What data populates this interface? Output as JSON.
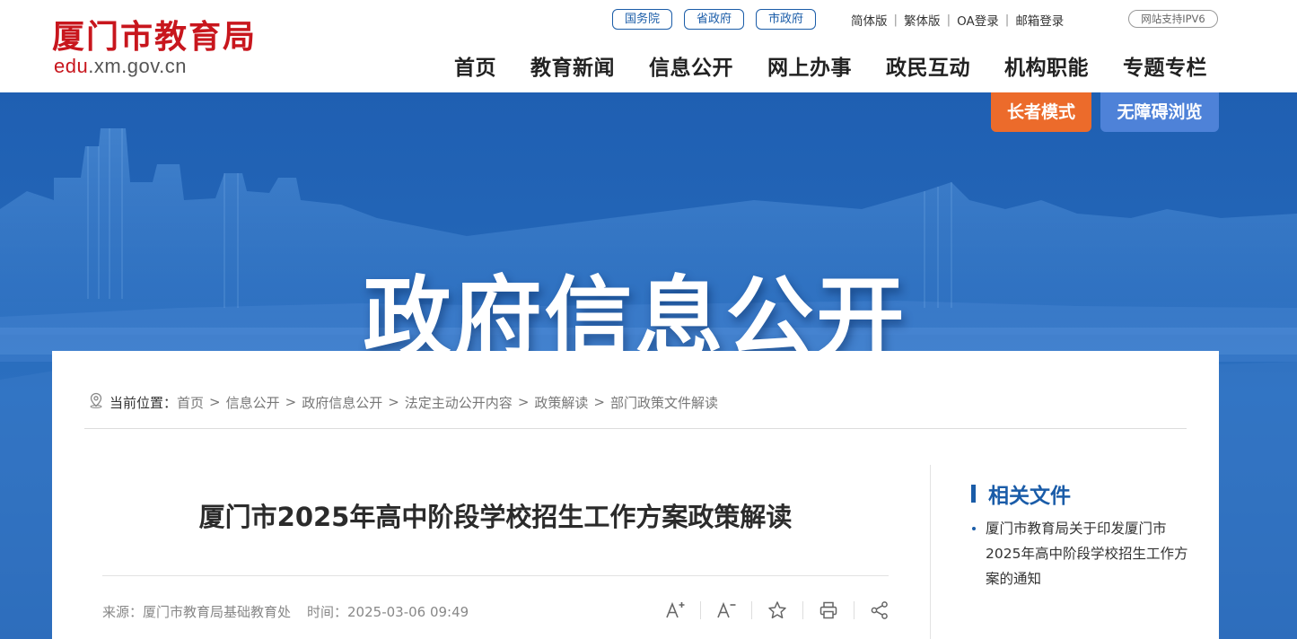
{
  "brand": {
    "title": "厦门市教育局",
    "domain_red": "edu",
    "domain_rest": ".xm.gov.cn"
  },
  "top_pills": [
    "国务院",
    "省政府",
    "市政府"
  ],
  "utility_links": [
    "简体版",
    "繁体版",
    "OA登录",
    "邮箱登录"
  ],
  "ipv6_badge": "网站支持IPV6",
  "nav": [
    "首页",
    "教育新闻",
    "信息公开",
    "网上办事",
    "政民互动",
    "机构职能",
    "专题专栏"
  ],
  "modes": {
    "elder": "长者模式",
    "accessible": "无障碍浏览"
  },
  "banner_title": "政府信息公开",
  "breadcrumb": {
    "label": "当前位置：",
    "items": [
      "首页",
      "信息公开",
      "政府信息公开",
      "法定主动公开内容",
      "政策解读",
      "部门政策文件解读"
    ],
    "separator": ">"
  },
  "article": {
    "title": "厦门市2025年高中阶段学校招生工作方案政策解读",
    "source": "来源：厦门市教育局基础教育处",
    "time": "时间：2025-03-06 09:49"
  },
  "tools": [
    "font-increase-icon",
    "font-decrease-icon",
    "star-icon",
    "print-icon",
    "share-icon"
  ],
  "related": {
    "title": "相关文件",
    "items": [
      "厦门市教育局关于印发厦门市2025年高中阶段学校招生工作方案的通知"
    ]
  },
  "colors": {
    "brand_red": "#c8161d",
    "primary_blue": "#1a5ca8",
    "elder_orange": "#ec6b2b",
    "access_blue": "#4e82d8"
  }
}
